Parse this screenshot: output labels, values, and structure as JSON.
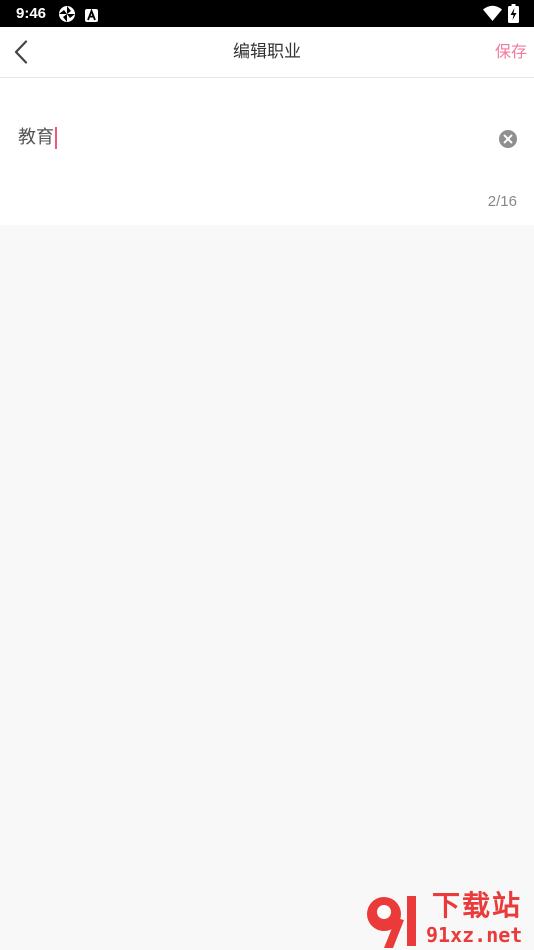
{
  "status_bar": {
    "time": "9:46",
    "icons": [
      "sync-icon",
      "a-badge-icon",
      "wifi-icon",
      "battery-charging-icon"
    ]
  },
  "nav": {
    "back_icon": "chevron-left-icon",
    "title": "编辑职业",
    "save_label": "保存"
  },
  "editor": {
    "value": "教育",
    "char_count": "2/16",
    "clear_icon": "clear-circle-icon"
  },
  "watermark": {
    "title": "下载站",
    "domain": "91xz.net"
  },
  "colors": {
    "accent": "#f07b9c",
    "caret": "#ee5b7a",
    "background": "#f8f8f8",
    "watermark": "#ea3a3a"
  }
}
